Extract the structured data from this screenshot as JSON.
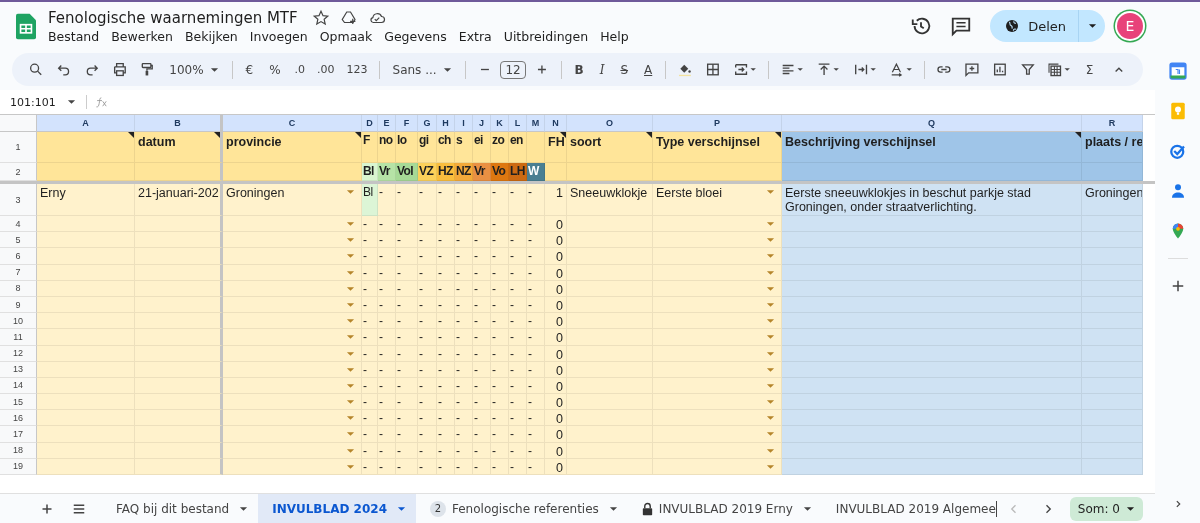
{
  "document": {
    "title": "Fenologische waarnemingen MTF",
    "menu": [
      "Bestand",
      "Bewerken",
      "Bekijken",
      "Invoegen",
      "Opmaak",
      "Gegevens",
      "Extra",
      "Uitbreidingen",
      "Help"
    ]
  },
  "actions": {
    "share_label": "Delen",
    "avatar_letter": "E"
  },
  "toolbar": {
    "zoom": "100%",
    "currency": "€",
    "percent": "%",
    "decrease_decimals": ".0",
    "increase_decimals": ".00",
    "number_format": "123",
    "font": "Sans ...",
    "font_size": "12",
    "bold": "B",
    "italic": "I",
    "strikethrough": "S",
    "text_color": "A",
    "sum": "Σ"
  },
  "formula_bar": {
    "name_box": "101:101"
  },
  "sheet": {
    "columns": [
      {
        "letter": "A"
      },
      {
        "letter": "B"
      },
      {
        "letter": "C",
        "dropdown": true
      },
      {
        "letter": "D"
      },
      {
        "letter": "E"
      },
      {
        "letter": "F"
      },
      {
        "letter": "G"
      },
      {
        "letter": "H"
      },
      {
        "letter": "I"
      },
      {
        "letter": "J"
      },
      {
        "letter": "K"
      },
      {
        "letter": "L"
      },
      {
        "letter": "M"
      },
      {
        "letter": "N"
      },
      {
        "letter": "O"
      },
      {
        "letter": "P",
        "dropdown": true
      },
      {
        "letter": "Q"
      },
      {
        "letter": "R"
      }
    ],
    "rows": [
      {
        "number": "1",
        "kind": "header",
        "cells": [
          {
            "text": "",
            "note": true
          },
          {
            "text": "datum",
            "note": true
          },
          {
            "text": "provincie",
            "note": true
          },
          "F",
          "no",
          "lo",
          "gi",
          "ch",
          "s",
          "ei",
          "zo",
          "en",
          "",
          {
            "text": "FH",
            "note": true
          },
          {
            "text": "soort",
            "note": true
          },
          {
            "text": "Type verschijnsel",
            "note": true
          },
          {
            "text": "Beschrijving verschijnsel",
            "note": true
          },
          "plaats / re"
        ]
      },
      {
        "number": "2",
        "kind": "header",
        "cells": [
          "",
          "",
          "",
          {
            "text": "Bl",
            "color": "#d9f5d0"
          },
          {
            "text": "Vr",
            "color": "#b6e3a6"
          },
          {
            "text": "Vol",
            "color": "#a6d996"
          },
          {
            "text": "VZ",
            "color": "#fcd15a"
          },
          {
            "text": "HZ",
            "color": "#f9bd3d"
          },
          {
            "text": "NZ",
            "color": "#f3a93a"
          },
          {
            "text": "Vr",
            "color": "#e99043"
          },
          {
            "text": "Vo",
            "color": "#dd7710"
          },
          {
            "text": "LH",
            "color": "#cc6a13"
          },
          {
            "text": "W",
            "color": "#4a7f92"
          },
          "",
          "",
          "",
          "",
          ""
        ]
      },
      {
        "number": "3",
        "kind": "data",
        "cells": [
          "Erny",
          "21-januari-202",
          "Groningen",
          {
            "text": "Bl",
            "color": "#dcf5d6"
          },
          "-",
          "-",
          "-",
          "-",
          "-",
          "-",
          "-",
          "-",
          "-",
          "1",
          "Sneeuwklokje",
          "Eerste bloei",
          "Eerste sneeuwklokjes in beschut parkje stad Groningen, onder straatverlichting.",
          "Groningen"
        ]
      },
      {
        "number": "4",
        "kind": "data",
        "cells": [
          "",
          "",
          "",
          "-",
          "-",
          "-",
          "-",
          "-",
          "-",
          "-",
          "-",
          "-",
          "-",
          "0",
          "",
          "",
          "",
          ""
        ]
      },
      {
        "number": "5",
        "kind": "data",
        "cells": [
          "",
          "",
          "",
          "-",
          "-",
          "-",
          "-",
          "-",
          "-",
          "-",
          "-",
          "-",
          "-",
          "0",
          "",
          "",
          "",
          ""
        ]
      },
      {
        "number": "6",
        "kind": "data",
        "cells": [
          "",
          "",
          "",
          "-",
          "-",
          "-",
          "-",
          "-",
          "-",
          "-",
          "-",
          "-",
          "-",
          "0",
          "",
          "",
          "",
          ""
        ]
      },
      {
        "number": "7",
        "kind": "data",
        "cells": [
          "",
          "",
          "",
          "-",
          "-",
          "-",
          "-",
          "-",
          "-",
          "-",
          "-",
          "-",
          "-",
          "0",
          "",
          "",
          "",
          ""
        ]
      },
      {
        "number": "8",
        "kind": "data",
        "cells": [
          "",
          "",
          "",
          "-",
          "-",
          "-",
          "-",
          "-",
          "-",
          "-",
          "-",
          "-",
          "-",
          "0",
          "",
          "",
          "",
          ""
        ]
      },
      {
        "number": "9",
        "kind": "data",
        "cells": [
          "",
          "",
          "",
          "-",
          "-",
          "-",
          "-",
          "-",
          "-",
          "-",
          "-",
          "-",
          "-",
          "0",
          "",
          "",
          "",
          ""
        ]
      },
      {
        "number": "10",
        "kind": "data",
        "cells": [
          "",
          "",
          "",
          "-",
          "-",
          "-",
          "-",
          "-",
          "-",
          "-",
          "-",
          "-",
          "-",
          "0",
          "",
          "",
          "",
          ""
        ]
      },
      {
        "number": "11",
        "kind": "data",
        "cells": [
          "",
          "",
          "",
          "-",
          "-",
          "-",
          "-",
          "-",
          "-",
          "-",
          "-",
          "-",
          "-",
          "0",
          "",
          "",
          "",
          ""
        ]
      },
      {
        "number": "12",
        "kind": "data",
        "cells": [
          "",
          "",
          "",
          "-",
          "-",
          "-",
          "-",
          "-",
          "-",
          "-",
          "-",
          "-",
          "-",
          "0",
          "",
          "",
          "",
          ""
        ]
      },
      {
        "number": "13",
        "kind": "data",
        "cells": [
          "",
          "",
          "",
          "-",
          "-",
          "-",
          "-",
          "-",
          "-",
          "-",
          "-",
          "-",
          "-",
          "0",
          "",
          "",
          "",
          ""
        ]
      },
      {
        "number": "14",
        "kind": "data",
        "cells": [
          "",
          "",
          "",
          "-",
          "-",
          "-",
          "-",
          "-",
          "-",
          "-",
          "-",
          "-",
          "-",
          "0",
          "",
          "",
          "",
          ""
        ]
      },
      {
        "number": "15",
        "kind": "data",
        "cells": [
          "",
          "",
          "",
          "-",
          "-",
          "-",
          "-",
          "-",
          "-",
          "-",
          "-",
          "-",
          "-",
          "0",
          "",
          "",
          "",
          ""
        ]
      },
      {
        "number": "16",
        "kind": "data",
        "cells": [
          "",
          "",
          "",
          "-",
          "-",
          "-",
          "-",
          "-",
          "-",
          "-",
          "-",
          "-",
          "-",
          "0",
          "",
          "",
          "",
          ""
        ]
      },
      {
        "number": "17",
        "kind": "data",
        "cells": [
          "",
          "",
          "",
          "-",
          "-",
          "-",
          "-",
          "-",
          "-",
          "-",
          "-",
          "-",
          "-",
          "0",
          "",
          "",
          "",
          ""
        ]
      },
      {
        "number": "18",
        "kind": "data",
        "cells": [
          "",
          "",
          "",
          "-",
          "-",
          "-",
          "-",
          "-",
          "-",
          "-",
          "-",
          "-",
          "-",
          "0",
          "",
          "",
          "",
          ""
        ]
      },
      {
        "number": "19",
        "kind": "data",
        "cells": [
          "",
          "",
          "",
          "-",
          "-",
          "-",
          "-",
          "-",
          "-",
          "-",
          "-",
          "-",
          "-",
          "0",
          "",
          "",
          "",
          ""
        ]
      }
    ]
  },
  "sheet_tabs": [
    {
      "label": "FAQ bij dit bestand",
      "selected": false,
      "locked": false,
      "dropdown": true
    },
    {
      "label": "INVULBLAD 2024",
      "selected": true,
      "locked": false,
      "dropdown": true
    },
    {
      "label": "Fenologische referenties",
      "selected": false,
      "locked": false,
      "dropdown": true,
      "badge": "2"
    },
    {
      "label": "INVULBLAD 2019 Erny",
      "selected": false,
      "locked": true,
      "dropdown": true
    },
    {
      "label": "INVULBLAD 2019 Algemee",
      "selected": false,
      "locked": false,
      "dropdown": false
    }
  ],
  "sum_label": "Som: 0"
}
